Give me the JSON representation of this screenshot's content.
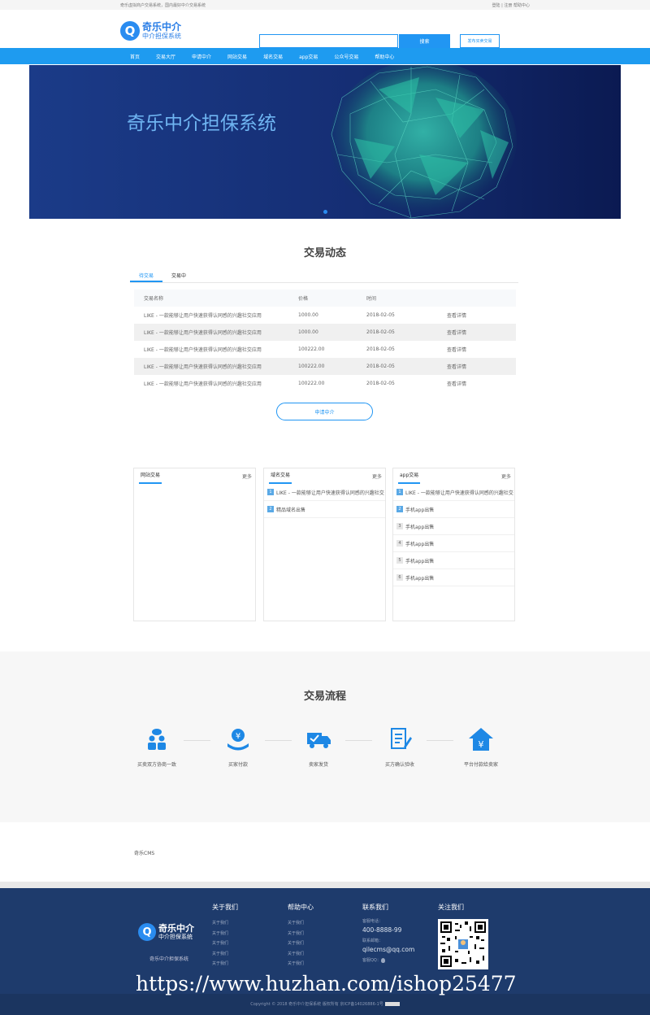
{
  "topbar": {
    "left": "奇乐虚拟商户交易系统，国内最好中介交易系统",
    "right": "登陆 | 注册 帮助中心"
  },
  "header": {
    "logo_main": "奇乐中介",
    "logo_sub": "中介担保系统",
    "search_button": "搜索",
    "publish_button": "发布买卖交易"
  },
  "nav": [
    "首页",
    "交易大厅",
    "申请中介",
    "网站交易",
    "域名交易",
    "app交易",
    "公众号交易",
    "帮助中心"
  ],
  "banner": {
    "title": "奇乐中介担保系统"
  },
  "activity": {
    "title": "交易动态",
    "tabs": [
      "待交易",
      "交易中"
    ],
    "columns": [
      "交易名称",
      "价格",
      "时间"
    ],
    "rows": [
      {
        "name": "LIKE - 一款能够让用户快速获得认同感的兴趣社交应用",
        "price": "1000.00",
        "date": "2018-02-05",
        "action": "查看详情"
      },
      {
        "name": "LIKE - 一款能够让用户快速获得认同感的兴趣社交应用",
        "price": "1000.00",
        "date": "2018-02-05",
        "action": "查看详情"
      },
      {
        "name": "LIKE - 一款能够让用户快速获得认同感的兴趣社交应用",
        "price": "100222.00",
        "date": "2018-02-05",
        "action": "查看详情"
      },
      {
        "name": "LIKE - 一款能够让用户快速获得认同感的兴趣社交应用",
        "price": "100222.00",
        "date": "2018-02-05",
        "action": "查看详情"
      },
      {
        "name": "LIKE - 一款能够让用户快速获得认同感的兴趣社交应用",
        "price": "100222.00",
        "date": "2018-02-05",
        "action": "查看详情"
      }
    ],
    "apply_button": "申请中介"
  },
  "boxes": [
    {
      "title": "网站交易",
      "more": "更多",
      "items": []
    },
    {
      "title": "域名交易",
      "more": "更多",
      "items": [
        "LIKE - 一款能够让用户快速获得认同感的兴趣社交",
        "精品域名出售"
      ]
    },
    {
      "title": "app交易",
      "more": "更多",
      "items": [
        "LIKE - 一款能够让用户快速获得认同感的兴趣社交",
        "手机app出售",
        "手机app出售",
        "手机app出售",
        "手机app出售",
        "手机app出售"
      ]
    }
  ],
  "process": {
    "title": "交易流程",
    "steps": [
      "买卖双方协商一致",
      "买家付款",
      "卖家发货",
      "买方确认验收",
      "平台付款给卖家"
    ]
  },
  "links": {
    "text": "奇乐CMS"
  },
  "footer": {
    "logo_main": "奇乐中介",
    "logo_sub": "中介担保系统",
    "name": "奇乐中介担保系统",
    "about": {
      "title": "关于我们",
      "items": [
        "关于我们",
        "关于我们",
        "关于我们",
        "关于我们",
        "关于我们"
      ]
    },
    "help": {
      "title": "帮助中心",
      "items": [
        "关于我们",
        "关于我们",
        "关于我们",
        "关于我们",
        "关于我们"
      ]
    },
    "contact": {
      "title": "联系我们",
      "phone_label": "客服电话：",
      "phone": "400-8888-99",
      "email_label": "联系邮箱：",
      "email": "qilecms@qq.com",
      "qq_label": "客服QQ："
    },
    "follow": {
      "title": "关注我们"
    },
    "watermark": "https://www.huzhan.com/ishop25477",
    "copyright": "Copyright © 2018 奇乐中介担保系统 版权所有 京ICP备14026886-1号"
  },
  "colors": {
    "primary": "#2196f3",
    "nav": "#1e9bf0",
    "footer": "#1e3b6c"
  }
}
